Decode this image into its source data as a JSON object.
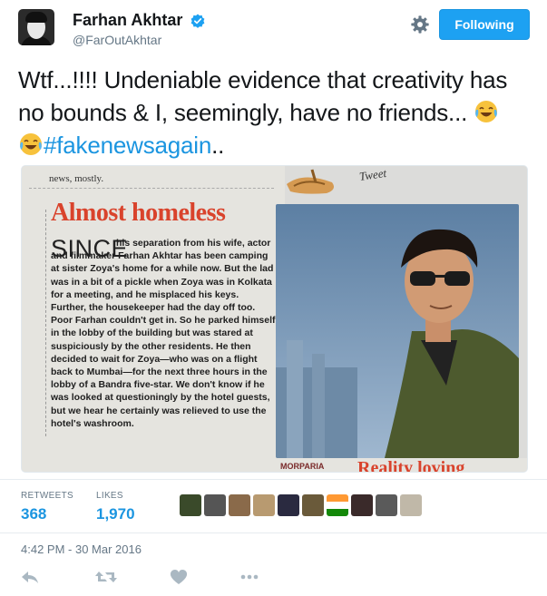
{
  "user": {
    "name": "Farhan Akhtar",
    "handle": "@FarOutAkhtar",
    "follow_label": "Following"
  },
  "tweet": {
    "text": "Wtf...!!!! Undeniable evidence that creativity has no bounds & I, seemingly, have no friends... ",
    "hashtag": "#fakenewsagain",
    "tail": "..",
    "emoji_icon": "face-with-tears-of-joy-icon"
  },
  "media": {
    "topline": "news, mostly.",
    "headline": "Almost homeless",
    "since": "SINCE",
    "article": "his separation from his wife, actor and filmmaker Farhan Akhtar has been camping at sister Zoya's home for a while now. But the lad was in a bit of a pickle when Zoya was in Kolkata for a meeting, and he misplaced his keys. Further, the housekeeper had the day off too. Poor Farhan couldn't get in. So he parked himself in the lobby of the building but was stared at suspiciously by the other residents. He then decided to wait for Zoya—who was on a flight back to Mumbai—for the next three hours in the lobby of a Bandra five-star. We don't know if he was looked at questioningly by the hotel guests, but we hear he certainly was relieved to use the hotel's washroom.",
    "stamp": "Tweet",
    "footer_left": "MORPARIA",
    "footer_right": "Reality loving"
  },
  "stats": {
    "retweets_label": "RETWEETS",
    "retweets_value": "368",
    "likes_label": "LIKES",
    "likes_value": "1,970"
  },
  "timestamp": "4:42 PM - 30 Mar 2016",
  "colors": {
    "accent": "#1da1f2",
    "link": "#1b95e0",
    "muted": "#657786",
    "headline_red": "#d9432c"
  }
}
